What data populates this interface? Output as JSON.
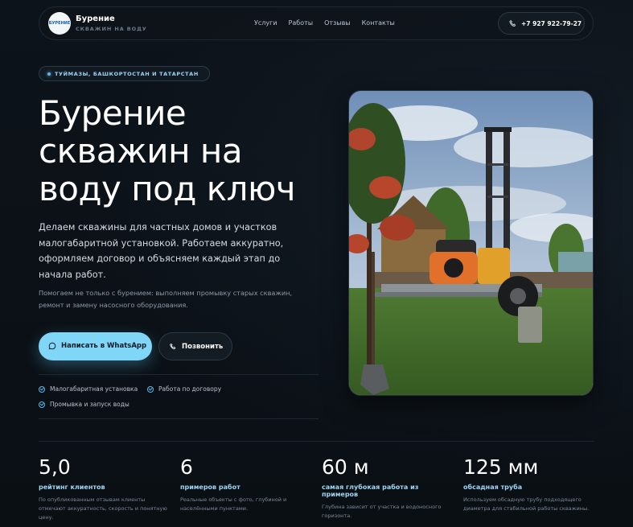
{
  "header": {
    "brand_name": "Бурение",
    "brand_sub": "СКВАЖИН НА ВОДУ",
    "logo_text": "БУРЕНИЕ",
    "nav": [
      "Услуги",
      "Работы",
      "Отзывы",
      "Контакты"
    ],
    "phone": "+7 927 922-79-27"
  },
  "hero": {
    "location": "ТУЙМАЗЫ, БАШКОРТОСТАН И ТАТАРСТАН",
    "title_lines": [
      "Бурение",
      "скважин на",
      "воду под ключ"
    ],
    "description": "Делаем скважины для частных домов и участков малогабаритной установкой. Работаем аккуратно, оформляем договор и объясняем каждый этап до начала работ.",
    "sub": "Помогаем не только с бурением: выполняем промывку старых скважин, ремонт и замену насосного оборудования.",
    "whatsapp_label": "Написать в WhatsApp",
    "call_label": "Позвонить",
    "features": [
      "Малогабаритная установка",
      "Работа по договору",
      "Промывка и запуск воды"
    ]
  },
  "stats": [
    {
      "value": "5,0",
      "label": "рейтинг клиентов",
      "desc": "По опубликованным отзывам клиенты отмечают аккуратность, скорость и понятную цену."
    },
    {
      "value": "6",
      "label": "примеров работ",
      "desc": "Реальные объекты с фото, глубиной и населёнными пунктами."
    },
    {
      "value": "60 м",
      "label": "самая глубокая работа из примеров",
      "desc": "Глубина зависит от участка и водоносного горизонта."
    },
    {
      "value": "125 мм",
      "label": "обсадная труба",
      "desc": "Используем обсадную трубу подходящего диаметра для стабильной работы скважины."
    }
  ],
  "colors": {
    "accent": "#7fd6f7",
    "accent_text": "#9fd4f2",
    "background": "#0b1016"
  },
  "icons": {
    "phone": "phone-icon",
    "whatsapp": "chat-bubble-icon",
    "check": "check-circle-icon",
    "location_dot": "dot-icon"
  }
}
